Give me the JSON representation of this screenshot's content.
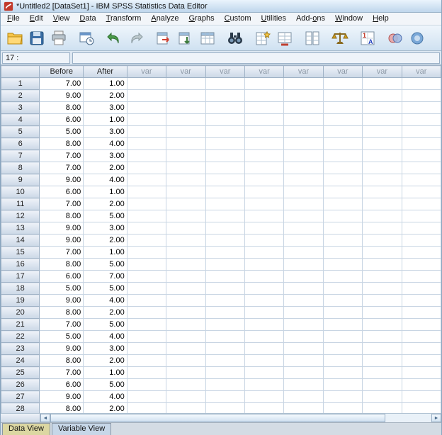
{
  "window": {
    "title": "*Untitled2 [DataSet1] - IBM SPSS Statistics Data Editor"
  },
  "menu": {
    "items": [
      {
        "pre": "",
        "key": "F",
        "post": "ile"
      },
      {
        "pre": "",
        "key": "E",
        "post": "dit"
      },
      {
        "pre": "",
        "key": "V",
        "post": "iew"
      },
      {
        "pre": "",
        "key": "D",
        "post": "ata"
      },
      {
        "pre": "",
        "key": "T",
        "post": "ransform"
      },
      {
        "pre": "",
        "key": "A",
        "post": "nalyze"
      },
      {
        "pre": "",
        "key": "G",
        "post": "raphs"
      },
      {
        "pre": "",
        "key": "C",
        "post": "ustom"
      },
      {
        "pre": "",
        "key": "U",
        "post": "tilities"
      },
      {
        "pre": "Add-",
        "key": "o",
        "post": "ns"
      },
      {
        "pre": "",
        "key": "W",
        "post": "indow"
      },
      {
        "pre": "",
        "key": "H",
        "post": "elp"
      }
    ]
  },
  "toolbar": {
    "groups": [
      [
        "open-data",
        "save",
        "print"
      ],
      [
        "recall-dialogs"
      ],
      [
        "undo",
        "redo"
      ],
      [
        "goto-case",
        "goto-variable",
        "variables"
      ],
      [
        "find"
      ],
      [
        "insert-cases",
        "insert-variable"
      ],
      [
        "split-file"
      ],
      [
        "weight-cases"
      ],
      [
        "value-labels"
      ],
      [
        "use-variable-sets",
        "show-all-variables"
      ]
    ]
  },
  "cell_reference": {
    "label": "17 :",
    "value": ""
  },
  "grid": {
    "data_columns": [
      "Before",
      "After"
    ],
    "var_column_label": "var",
    "var_column_count": 8,
    "rows": [
      {
        "n": "1",
        "values": [
          "7.00",
          "1.00"
        ]
      },
      {
        "n": "2",
        "values": [
          "9.00",
          "2.00"
        ]
      },
      {
        "n": "3",
        "values": [
          "8.00",
          "3.00"
        ]
      },
      {
        "n": "4",
        "values": [
          "6.00",
          "1.00"
        ]
      },
      {
        "n": "5",
        "values": [
          "5.00",
          "3.00"
        ]
      },
      {
        "n": "6",
        "values": [
          "8.00",
          "4.00"
        ]
      },
      {
        "n": "7",
        "values": [
          "7.00",
          "3.00"
        ]
      },
      {
        "n": "8",
        "values": [
          "7.00",
          "2.00"
        ]
      },
      {
        "n": "9",
        "values": [
          "9.00",
          "4.00"
        ]
      },
      {
        "n": "10",
        "values": [
          "6.00",
          "1.00"
        ]
      },
      {
        "n": "11",
        "values": [
          "7.00",
          "2.00"
        ]
      },
      {
        "n": "12",
        "values": [
          "8.00",
          "5.00"
        ]
      },
      {
        "n": "13",
        "values": [
          "9.00",
          "3.00"
        ]
      },
      {
        "n": "14",
        "values": [
          "9.00",
          "2.00"
        ]
      },
      {
        "n": "15",
        "values": [
          "7.00",
          "1.00"
        ]
      },
      {
        "n": "16",
        "values": [
          "8.00",
          "5.00"
        ]
      },
      {
        "n": "17",
        "values": [
          "6.00",
          "7.00"
        ]
      },
      {
        "n": "18",
        "values": [
          "5.00",
          "5.00"
        ]
      },
      {
        "n": "19",
        "values": [
          "9.00",
          "4.00"
        ]
      },
      {
        "n": "20",
        "values": [
          "8.00",
          "2.00"
        ]
      },
      {
        "n": "21",
        "values": [
          "7.00",
          "5.00"
        ]
      },
      {
        "n": "22",
        "values": [
          "5.00",
          "4.00"
        ]
      },
      {
        "n": "23",
        "values": [
          "9.00",
          "3.00"
        ]
      },
      {
        "n": "24",
        "values": [
          "8.00",
          "2.00"
        ]
      },
      {
        "n": "25",
        "values": [
          "7.00",
          "1.00"
        ]
      },
      {
        "n": "26",
        "values": [
          "6.00",
          "5.00"
        ]
      },
      {
        "n": "27",
        "values": [
          "9.00",
          "4.00"
        ]
      },
      {
        "n": "28",
        "values": [
          "8.00",
          "2.00"
        ]
      }
    ]
  },
  "scrollbar": {
    "left_arrow": "◄",
    "right_arrow": "►"
  },
  "tabs": [
    {
      "label": "Data View",
      "active": true
    },
    {
      "label": "Variable View",
      "active": false
    }
  ],
  "colors": {
    "accent_blue": "#cfe1f1",
    "header_blue": "#ccd8e7",
    "active_tab_tan": "#dcd7a2"
  }
}
